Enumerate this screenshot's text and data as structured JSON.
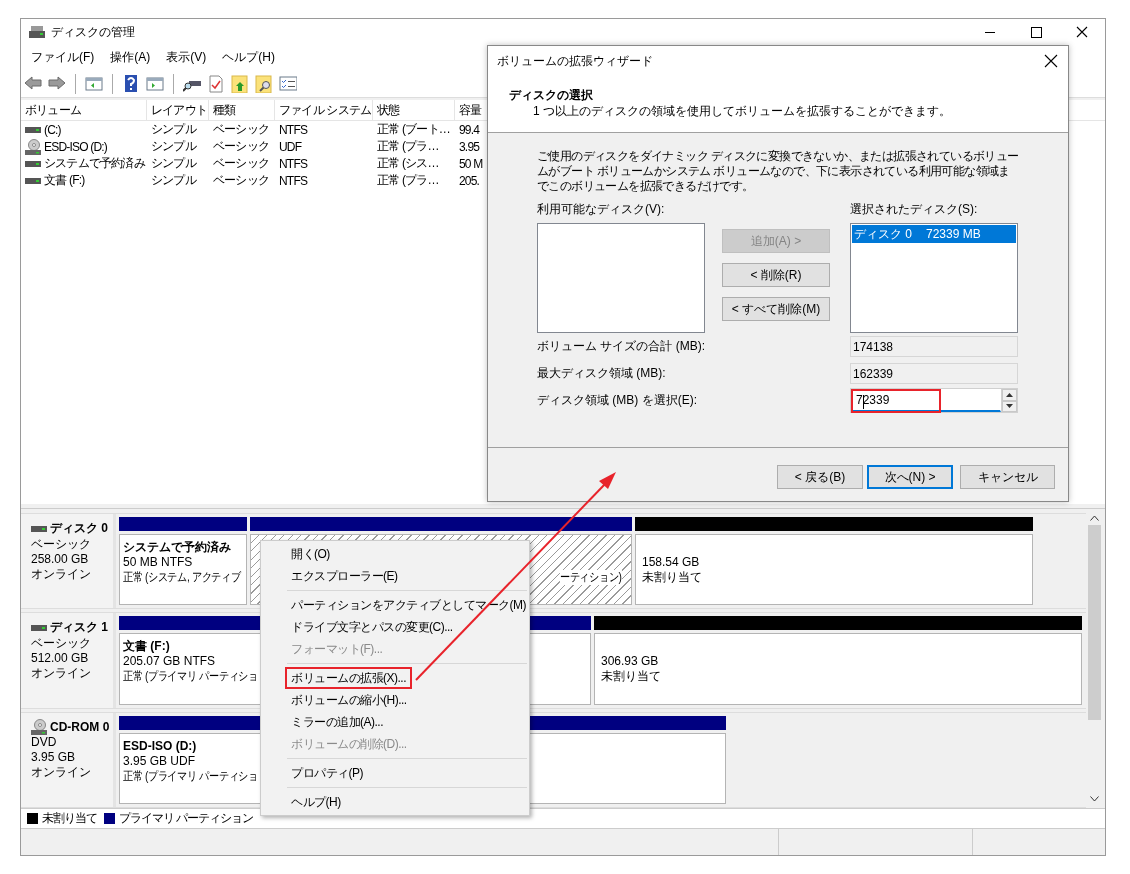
{
  "window": {
    "title": "ディスクの管理"
  },
  "menu_bar": [
    "ファイル(F)",
    "操作(A)",
    "表示(V)",
    "ヘルプ(H)"
  ],
  "toolbar": [
    {
      "kind": "back"
    },
    {
      "kind": "forward"
    },
    {
      "kind": "separator"
    },
    {
      "kind": "tree"
    },
    {
      "kind": "separator"
    },
    {
      "kind": "help"
    },
    {
      "kind": "pane"
    },
    {
      "kind": "separator"
    },
    {
      "kind": "connect"
    },
    {
      "kind": "check"
    },
    {
      "kind": "upload"
    },
    {
      "kind": "explore"
    },
    {
      "kind": "list"
    }
  ],
  "volume_table": {
    "columns": [
      "ボリューム",
      "レイアウト",
      "種類",
      "ファイル システム",
      "状態",
      "容量"
    ],
    "rows": [
      {
        "kind": "disk",
        "cells": [
          "(C:)",
          "シンプル",
          "ベーシック",
          "NTFS",
          "正常 (ブート…",
          "99.4"
        ]
      },
      {
        "kind": "cdrom",
        "cells": [
          "ESD-ISO (D:)",
          "シンプル",
          "ベーシック",
          "UDF",
          "正常 (プラ…",
          "3.95"
        ]
      },
      {
        "kind": "disk",
        "cells": [
          "システムで予約済み",
          "シンプル",
          "ベーシック",
          "NTFS",
          "正常 (シス…",
          "50 M"
        ]
      },
      {
        "kind": "disk",
        "cells": [
          "文書 (F:)",
          "シンプル",
          "ベーシック",
          "NTFS",
          "正常 (プラ…",
          "205."
        ]
      }
    ]
  },
  "disks": [
    {
      "kind": "disk",
      "name": "ディスク 0",
      "type": "ベーシック",
      "size": "258.00 GB",
      "status": "オンライン",
      "partitions": [
        {
          "kind": "primary",
          "selected": false,
          "name": "システムで予約済み",
          "size": "50 MB NTFS",
          "status": "正常 (システム, アクティブ"
        },
        {
          "kind": "primary",
          "selected": true,
          "status": "ーティション)"
        },
        {
          "kind": "unallocated",
          "selected": false,
          "size": "158.54 GB",
          "status": "未割り当て"
        }
      ]
    },
    {
      "kind": "disk",
      "name": "ディスク 1",
      "type": "ベーシック",
      "size": "512.00 GB",
      "status": "オンライン",
      "partitions": [
        {
          "kind": "primary",
          "selected": false,
          "name": "文書 (F:)",
          "size": "205.07 GB NTFS",
          "status": "正常 (プライマリ パーティショ"
        },
        {
          "kind": "unallocated",
          "selected": false,
          "size": "306.93 GB",
          "status": "未割り当て"
        }
      ]
    },
    {
      "kind": "cdrom",
      "name": "CD-ROM 0",
      "type": "DVD",
      "size": "3.95 GB",
      "status": "オンライン",
      "partitions": [
        {
          "kind": "primary",
          "selected": false,
          "name": "ESD-ISO (D:)",
          "size": "3.95 GB UDF",
          "status": "正常 (プライマリ パーティショ"
        }
      ]
    }
  ],
  "legend": [
    {
      "kind": "unallocated",
      "label": "未割り当て",
      "color": "#000000"
    },
    {
      "kind": "primary",
      "label": "プライマリ パーティション",
      "color": "#000080"
    }
  ],
  "dialog": {
    "title": "ボリュームの拡張ウィザード",
    "heading": "ディスクの選択",
    "subheading": "1 つ以上のディスクの領域を使用してボリュームを拡張することができます。",
    "description": "ご使用のディスクをダイナミック ディスクに変換できないか、または拡張されているボリュームがブート ボリュームかシステム ボリュームなので、下に表示されている利用可能な領域までこのボリュームを拡張できるだけです。",
    "available_label": "利用可能なディスク(V):",
    "selected_label": "選択されたディスク(S):",
    "selected_disks": [
      {
        "name": "ディスク 0",
        "size": "72339 MB",
        "selected": true
      }
    ],
    "move_buttons": [
      {
        "label": "追加(A) >",
        "disabled": true
      },
      {
        "label": "< 削除(R)",
        "disabled": false
      },
      {
        "label": "< すべて削除(M)",
        "disabled": false
      }
    ],
    "fields": [
      {
        "kind": "readonly",
        "label": "ボリューム サイズの合計 (MB):",
        "value": "174138"
      },
      {
        "kind": "readonly",
        "label": "最大ディスク領域 (MB):",
        "value": "162339"
      },
      {
        "kind": "spin",
        "label": "ディスク領域 (MB) を選択(E):",
        "value": "72339",
        "focused": true,
        "highlighted": true
      }
    ],
    "buttons": [
      {
        "label": "< 戻る(B)",
        "default": false
      },
      {
        "label": "次へ(N) >",
        "default": true
      },
      {
        "label": "キャンセル",
        "default": false
      }
    ]
  },
  "context_menu": [
    {
      "kind": "item",
      "label": "開く(O)",
      "disabled": false,
      "highlighted": false
    },
    {
      "kind": "item",
      "label": "エクスプローラー(E)",
      "disabled": false,
      "highlighted": false
    },
    {
      "kind": "separator"
    },
    {
      "kind": "item",
      "label": "パーティションをアクティブとしてマーク(M)",
      "disabled": false,
      "highlighted": false
    },
    {
      "kind": "item",
      "label": "ドライブ文字とパスの変更(C)...",
      "disabled": false,
      "highlighted": false
    },
    {
      "kind": "item",
      "label": "フォーマット(F)...",
      "disabled": true,
      "highlighted": false
    },
    {
      "kind": "separator"
    },
    {
      "kind": "item",
      "label": "ボリュームの拡張(X)...",
      "disabled": false,
      "highlighted": true
    },
    {
      "kind": "item",
      "label": "ボリュームの縮小(H)...",
      "disabled": false,
      "highlighted": false
    },
    {
      "kind": "item",
      "label": "ミラーの追加(A)...",
      "disabled": false,
      "highlighted": false
    },
    {
      "kind": "item",
      "label": "ボリュームの削除(D)...",
      "disabled": true,
      "highlighted": false
    },
    {
      "kind": "separator"
    },
    {
      "kind": "item",
      "label": "プロパティ(P)",
      "disabled": false,
      "highlighted": false
    },
    {
      "kind": "separator"
    },
    {
      "kind": "item",
      "label": "ヘルプ(H)",
      "disabled": false,
      "highlighted": false
    }
  ],
  "annotation": {
    "kind": "arrow"
  }
}
